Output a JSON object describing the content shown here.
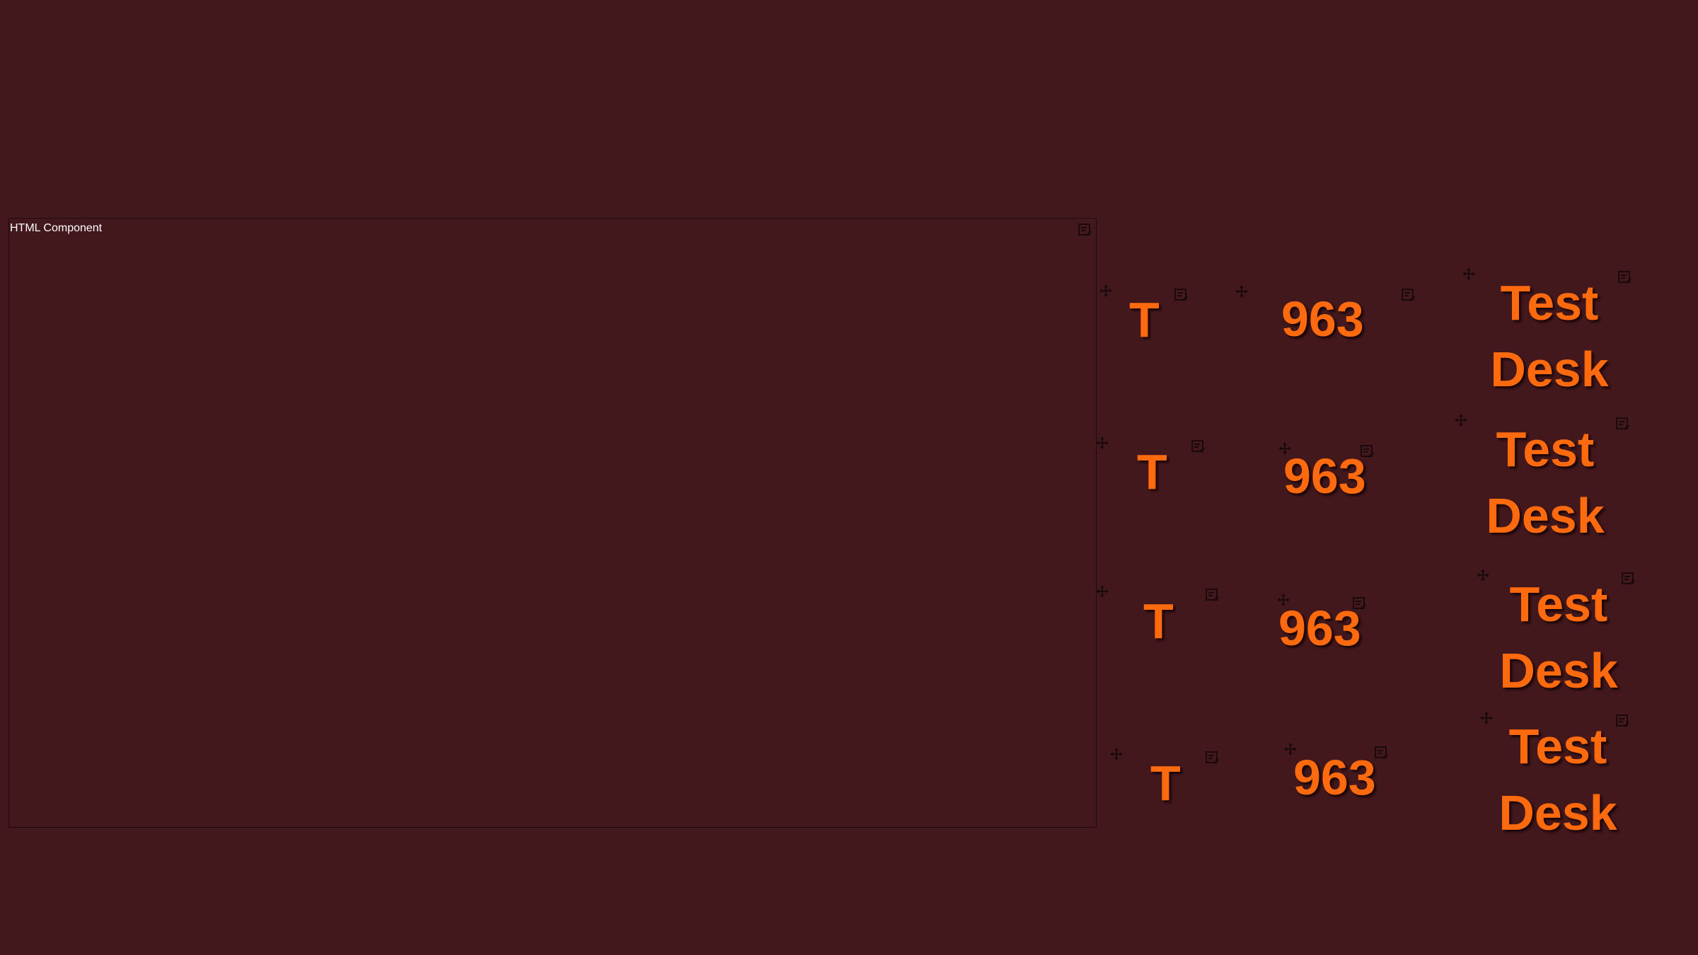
{
  "html_component": {
    "label": "HTML Component"
  },
  "widgets": {
    "letter": "T",
    "number": "963",
    "word1": "Test",
    "word2": "Desk"
  },
  "icons": {
    "edit": "edit-icon",
    "move": "move-icon"
  },
  "colors": {
    "background": "#42181c",
    "text": "#ff6a0e",
    "label": "#ffffff",
    "icon": "#1a0a0c"
  }
}
